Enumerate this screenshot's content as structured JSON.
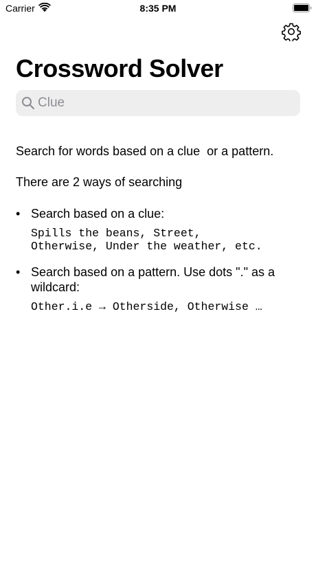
{
  "status_bar": {
    "carrier": "Carrier",
    "time": "8:35 PM"
  },
  "header": {
    "title": "Crossword Solver",
    "settings_icon": "gear-icon"
  },
  "search": {
    "placeholder": "Clue",
    "value": "",
    "icon": "search-icon"
  },
  "content": {
    "intro": "Search for words based on a clue  or a pattern.",
    "ways": "There are 2 ways of searching",
    "bullets": [
      {
        "text": "Search based on a clue:",
        "example": "Spills the beans, Street,\nOtherwise, Under the weather, etc."
      },
      {
        "text": "Search based on a pattern. Use dots \".\" as a wildcard:",
        "example": "Other.i.e → Otherside, Otherwise …"
      }
    ],
    "bullet_symbol": "•"
  },
  "colors": {
    "background": "#ffffff",
    "text": "#000000",
    "search_background": "#eeeeef",
    "placeholder": "#8e8e93"
  }
}
